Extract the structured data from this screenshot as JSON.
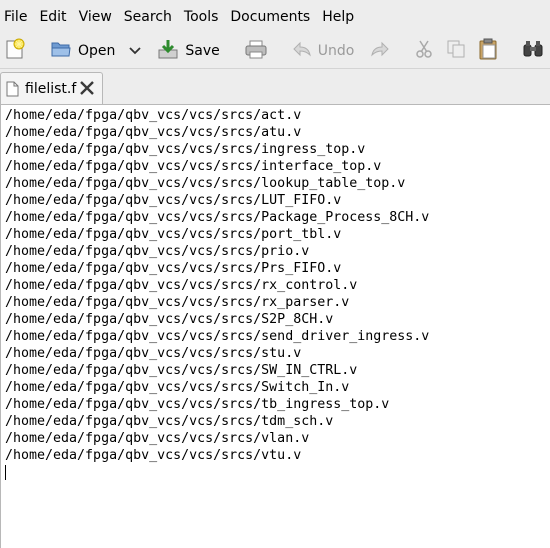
{
  "menubar": {
    "items": [
      "File",
      "Edit",
      "View",
      "Search",
      "Tools",
      "Documents",
      "Help"
    ]
  },
  "toolbar": {
    "new_icon": "new-document-icon",
    "open_label": "Open",
    "save_label": "Save",
    "print_icon": "print-icon",
    "undo_label": "Undo",
    "redo_icon": "redo-icon",
    "cut_icon": "cut-icon",
    "copy_icon": "copy-icon",
    "paste_icon": "paste-icon",
    "find_icon": "binoculars-icon"
  },
  "tabs": [
    {
      "label": "filelist.f"
    }
  ],
  "editor": {
    "lines": [
      "/home/eda/fpga/qbv_vcs/vcs/srcs/act.v",
      "/home/eda/fpga/qbv_vcs/vcs/srcs/atu.v",
      "/home/eda/fpga/qbv_vcs/vcs/srcs/ingress_top.v",
      "/home/eda/fpga/qbv_vcs/vcs/srcs/interface_top.v",
      "/home/eda/fpga/qbv_vcs/vcs/srcs/lookup_table_top.v",
      "/home/eda/fpga/qbv_vcs/vcs/srcs/LUT_FIFO.v",
      "/home/eda/fpga/qbv_vcs/vcs/srcs/Package_Process_8CH.v",
      "/home/eda/fpga/qbv_vcs/vcs/srcs/port_tbl.v",
      "/home/eda/fpga/qbv_vcs/vcs/srcs/prio.v",
      "/home/eda/fpga/qbv_vcs/vcs/srcs/Prs_FIFO.v",
      "/home/eda/fpga/qbv_vcs/vcs/srcs/rx_control.v",
      "/home/eda/fpga/qbv_vcs/vcs/srcs/rx_parser.v",
      "/home/eda/fpga/qbv_vcs/vcs/srcs/S2P_8CH.v",
      "/home/eda/fpga/qbv_vcs/vcs/srcs/send_driver_ingress.v",
      "/home/eda/fpga/qbv_vcs/vcs/srcs/stu.v",
      "/home/eda/fpga/qbv_vcs/vcs/srcs/SW_IN_CTRL.v",
      "/home/eda/fpga/qbv_vcs/vcs/srcs/Switch_In.v",
      "/home/eda/fpga/qbv_vcs/vcs/srcs/tb_ingress_top.v",
      "/home/eda/fpga/qbv_vcs/vcs/srcs/tdm_sch.v",
      "/home/eda/fpga/qbv_vcs/vcs/srcs/vlan.v",
      "/home/eda/fpga/qbv_vcs/vcs/srcs/vtu.v"
    ]
  }
}
